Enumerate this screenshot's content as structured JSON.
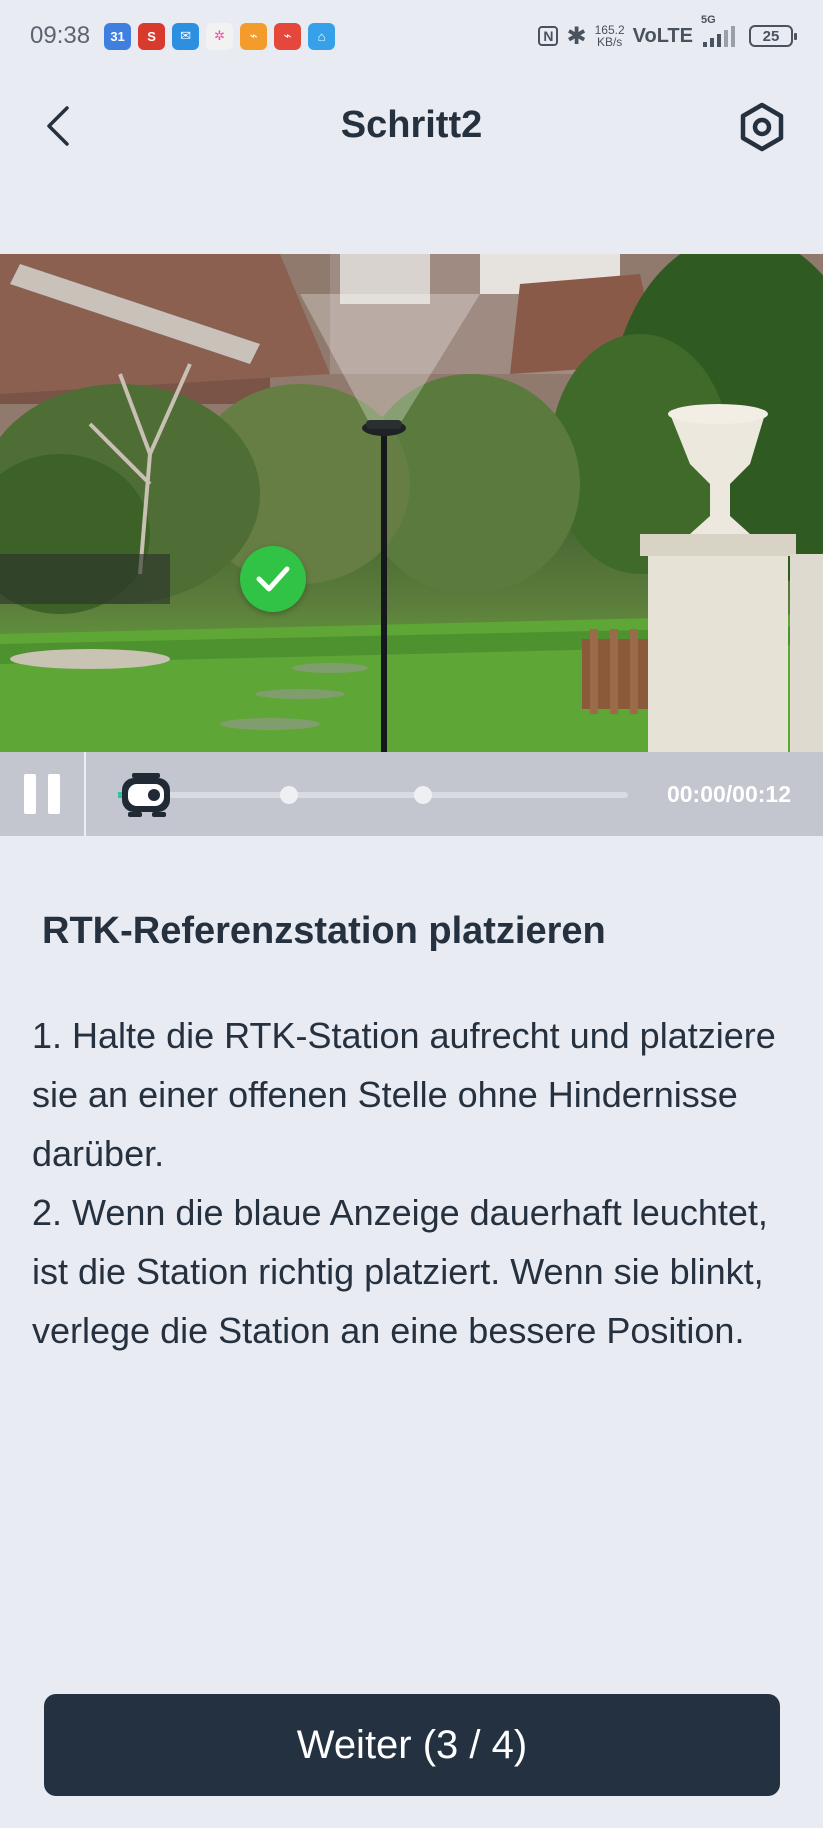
{
  "status_bar": {
    "time": "09:38",
    "app_icons": [
      {
        "name": "calendar-icon",
        "label": "31",
        "color": "#3f7fe0"
      },
      {
        "name": "s-app-icon",
        "label": "S",
        "color": "#d83a2e"
      },
      {
        "name": "mail-icon",
        "label": "✉",
        "color": "#2d8fe0"
      },
      {
        "name": "pinwheel-icon",
        "label": "✲",
        "color": "#f2f2f2"
      },
      {
        "name": "link-app-icon",
        "label": "⌁",
        "color": "#f39b2b"
      },
      {
        "name": "red-app-icon",
        "label": "⌁",
        "color": "#e5483a"
      },
      {
        "name": "home-app-icon",
        "label": "⌂",
        "color": "#36a0e8"
      }
    ],
    "nfc": "N",
    "speed_value": "165.2",
    "speed_unit": "KB/s",
    "network": "VoLTE",
    "signal_label": "5G",
    "battery": "25"
  },
  "header": {
    "title": "Schritt2"
  },
  "video": {
    "time": "00:00/00:12",
    "progress": 0.0
  },
  "content": {
    "section_title": "RTK-Referenzstation platzieren",
    "instructions": [
      "1. Halte die RTK-Station aufrecht und platziere sie an einer offenen Stelle ohne Hindernisse darüber.",
      "2. Wenn die blaue Anzeige dauerhaft leuchtet, ist die Station richtig platziert. Wenn sie blinkt, verlege die Station an eine bessere Position."
    ]
  },
  "footer": {
    "next_label": "Weiter (3 / 4)"
  }
}
